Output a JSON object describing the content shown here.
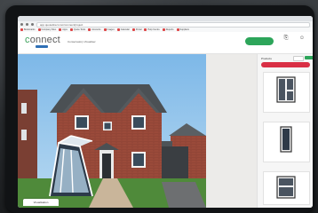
{
  "browser": {
    "url": "app.quotedirect.com/connect/project",
    "bookmarks": [
      "Bookmarks",
      "Company Files",
      "Apps",
      "Quote Tools",
      "Accounts",
      "Images",
      "Calendar",
      "Portal",
      "Help Centre",
      "Reports",
      "Suppliers"
    ]
  },
  "header": {
    "logo_text": "onnect",
    "logo_prefix": "c",
    "logo_sub": "",
    "project_title": "Conservatory Visualiser",
    "action_button": "",
    "icons": [
      {
        "name": "share-icon",
        "label": ""
      },
      {
        "name": "user-icon",
        "label": ""
      }
    ]
  },
  "panel": {
    "title": "Products",
    "toggle": [
      "",
      ""
    ],
    "cta_label": "",
    "products": [
      {
        "label": ""
      },
      {
        "label": ""
      },
      {
        "label": ""
      }
    ]
  },
  "bottom_tab": "Visualisation",
  "footer_note": "",
  "colors": {
    "accent_green": "#2da55a",
    "cta_red": "#d92f45",
    "brand_blue": "#2f6fb5"
  }
}
